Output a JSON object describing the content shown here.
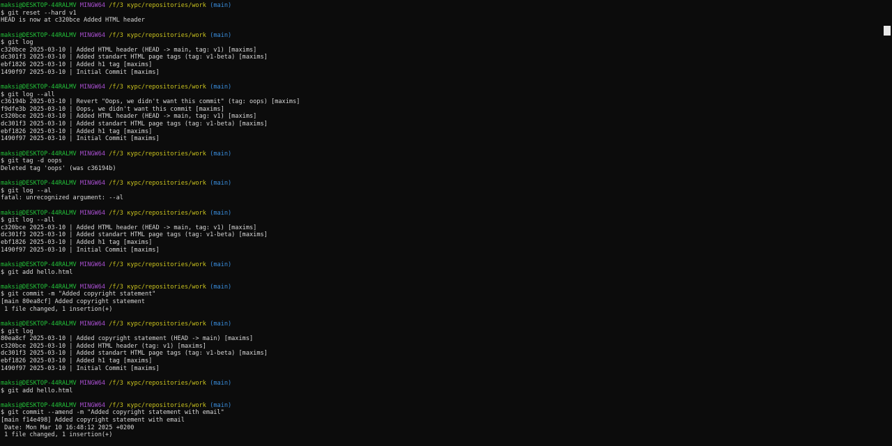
{
  "prompt": {
    "user": "maksi@DESKTOP-44RALMV",
    "system": "MINGW64",
    "path": "/f/3 курс/repositories/work",
    "branch": "(main)"
  },
  "lines": [
    {
      "type": "prompt"
    },
    {
      "type": "text",
      "text": "$ git reset --hard v1"
    },
    {
      "type": "text",
      "text": "HEAD is now at c320bce Added HTML header"
    },
    {
      "type": "text",
      "text": ""
    },
    {
      "type": "prompt"
    },
    {
      "type": "text",
      "text": "$ git log"
    },
    {
      "type": "text",
      "text": "c320bce 2025-03-10 | Added HTML header (HEAD -> main, tag: v1) [maxims]"
    },
    {
      "type": "text",
      "text": "dc301f3 2025-03-10 | Added standart HTML page tags (tag: v1-beta) [maxims]"
    },
    {
      "type": "text",
      "text": "ebf1826 2025-03-10 | Added h1 tag [maxims]"
    },
    {
      "type": "text",
      "text": "1490f97 2025-03-10 | Initial Commit [maxims]"
    },
    {
      "type": "text",
      "text": ""
    },
    {
      "type": "prompt"
    },
    {
      "type": "text",
      "text": "$ git log --all"
    },
    {
      "type": "text",
      "text": "c36194b 2025-03-10 | Revert \"Oops, we didn't want this commit\" (tag: oops) [maxims]"
    },
    {
      "type": "text",
      "text": "f9dfe3b 2025-03-10 | Oops, we didn't want this commit [maxims]"
    },
    {
      "type": "text",
      "text": "c320bce 2025-03-10 | Added HTML header (HEAD -> main, tag: v1) [maxims]"
    },
    {
      "type": "text",
      "text": "dc301f3 2025-03-10 | Added standart HTML page tags (tag: v1-beta) [maxims]"
    },
    {
      "type": "text",
      "text": "ebf1826 2025-03-10 | Added h1 tag [maxims]"
    },
    {
      "type": "text",
      "text": "1490f97 2025-03-10 | Initial Commit [maxims]"
    },
    {
      "type": "text",
      "text": ""
    },
    {
      "type": "prompt"
    },
    {
      "type": "text",
      "text": "$ git tag -d oops"
    },
    {
      "type": "text",
      "text": "Deleted tag 'oops' (was c36194b)"
    },
    {
      "type": "text",
      "text": ""
    },
    {
      "type": "prompt"
    },
    {
      "type": "text",
      "text": "$ git log --al"
    },
    {
      "type": "text",
      "text": "fatal: unrecognized argument: --al"
    },
    {
      "type": "text",
      "text": ""
    },
    {
      "type": "prompt"
    },
    {
      "type": "text",
      "text": "$ git log --all"
    },
    {
      "type": "text",
      "text": "c320bce 2025-03-10 | Added HTML header (HEAD -> main, tag: v1) [maxims]"
    },
    {
      "type": "text",
      "text": "dc301f3 2025-03-10 | Added standart HTML page tags (tag: v1-beta) [maxims]"
    },
    {
      "type": "text",
      "text": "ebf1826 2025-03-10 | Added h1 tag [maxims]"
    },
    {
      "type": "text",
      "text": "1490f97 2025-03-10 | Initial Commit [maxims]"
    },
    {
      "type": "text",
      "text": ""
    },
    {
      "type": "prompt"
    },
    {
      "type": "text",
      "text": "$ git add hello.html"
    },
    {
      "type": "text",
      "text": ""
    },
    {
      "type": "prompt"
    },
    {
      "type": "text",
      "text": "$ git commit -m \"Added copyright statement\""
    },
    {
      "type": "text",
      "text": "[main 80ea8cf] Added copyright statement"
    },
    {
      "type": "text",
      "text": " 1 file changed, 1 insertion(+)"
    },
    {
      "type": "text",
      "text": ""
    },
    {
      "type": "prompt"
    },
    {
      "type": "text",
      "text": "$ git log"
    },
    {
      "type": "text",
      "text": "80ea8cf 2025-03-10 | Added copyright statement (HEAD -> main) [maxims]"
    },
    {
      "type": "text",
      "text": "c320bce 2025-03-10 | Added HTML header (tag: v1) [maxims]"
    },
    {
      "type": "text",
      "text": "dc301f3 2025-03-10 | Added standart HTML page tags (tag: v1-beta) [maxims]"
    },
    {
      "type": "text",
      "text": "ebf1826 2025-03-10 | Added h1 tag [maxims]"
    },
    {
      "type": "text",
      "text": "1490f97 2025-03-10 | Initial Commit [maxims]"
    },
    {
      "type": "text",
      "text": ""
    },
    {
      "type": "prompt"
    },
    {
      "type": "text",
      "text": "$ git add hello.html"
    },
    {
      "type": "text",
      "text": ""
    },
    {
      "type": "prompt"
    },
    {
      "type": "text",
      "text": "$ git commit --amend -m \"Added copyright statement with email\""
    },
    {
      "type": "text",
      "text": "[main f14e498] Added copyright statement with email"
    },
    {
      "type": "text",
      "text": " Date: Mon Mar 10 16:48:12 2025 +0200"
    },
    {
      "type": "text",
      "text": " 1 file changed, 1 insertion(+)"
    }
  ],
  "colors": {
    "background": "#0c0c0c",
    "text": "#d9d9d9",
    "user": "#23c43a",
    "system": "#a94fd0",
    "path": "#c9c21e",
    "branch": "#3a8fe0"
  }
}
